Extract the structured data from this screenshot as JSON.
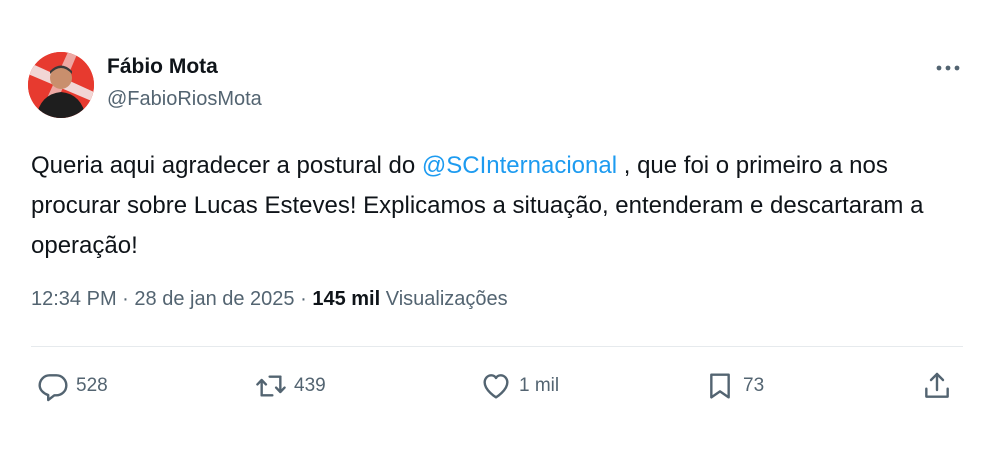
{
  "author": {
    "name": "Fábio Mota",
    "handle": "@FabioRiosMota"
  },
  "tweet": {
    "text_before": "Queria aqui agradecer a postural do ",
    "mention": "@SCInternacional",
    "text_after": " , que foi o primeiro a nos procurar sobre Lucas Esteves! Explicamos a situação, entenderam e descartaram a operação!"
  },
  "meta": {
    "time": "12:34 PM",
    "sep1": " · ",
    "date": "28 de jan de 2025",
    "sep2": " · ",
    "views_count": "145 mil",
    "views_label": " Visualizações"
  },
  "actions": {
    "replies": "528",
    "retweets": "439",
    "likes": "1 mil",
    "bookmarks": "73"
  },
  "colors": {
    "accent": "#1d9bf0",
    "secondary_text": "#536471",
    "avatar_bg": "#e73a2f"
  },
  "icons": [
    "more-icon",
    "reply-icon",
    "retweet-icon",
    "like-icon",
    "bookmark-icon",
    "share-icon"
  ]
}
